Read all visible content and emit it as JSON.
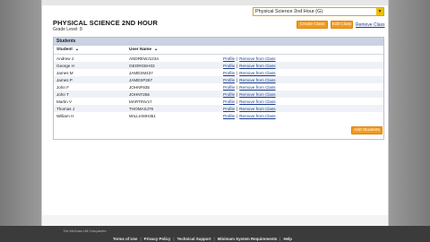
{
  "class_selector": {
    "value": "Physical Science 2nd Hour (G)"
  },
  "header": {
    "title": "PHYSICAL SCIENCE 2ND HOUR",
    "grade": "Grade Level: 8"
  },
  "actions": {
    "create_class": "Create Class",
    "edit_class": "Edit Class",
    "remove_class": "Remove Class"
  },
  "students": {
    "panel_title": "Students",
    "columns": {
      "student": "Student",
      "username": "User Name",
      "sort_glyph": "▲"
    },
    "rows": [
      {
        "student": "Andrew J",
        "username": "ANDREWJ1234",
        "profile": "Profile",
        "remove": "Remove from Class"
      },
      {
        "student": "George H",
        "username": "GEORGEH03",
        "profile": "Profile",
        "remove": "Remove from Class"
      },
      {
        "student": "James M",
        "username": "JAMESM437",
        "profile": "Profile",
        "remove": "Remove from Class"
      },
      {
        "student": "James P",
        "username": "JAMESP267",
        "profile": "Profile",
        "remove": "Remove from Class"
      },
      {
        "student": "John F",
        "username": "JOHNF935",
        "profile": "Profile",
        "remove": "Remove from Class"
      },
      {
        "student": "John T",
        "username": "JOHNT256",
        "profile": "Profile",
        "remove": "Remove from Class"
      },
      {
        "student": "Martin V",
        "username": "MARTINV17",
        "profile": "Profile",
        "remove": "Remove from Class"
      },
      {
        "student": "Thomas J",
        "username": "THOMASJ76",
        "profile": "Profile",
        "remove": "Remove from Class"
      },
      {
        "student": "William H",
        "username": "WILLIAMH351",
        "profile": "Profile",
        "remove": "Remove from Class"
      }
    ],
    "add_students": "Add Students"
  },
  "footer": {
    "logo_text": "The McGraw-Hill Companies",
    "links": [
      "Terms of Use",
      "Privacy Policy",
      "Technical Support",
      "Minimum System Requirements",
      "Help"
    ]
  },
  "colors": {
    "accent": "#f39a1c",
    "link": "#1a3d8c",
    "panel_header": "#c9d3e1",
    "footer": "#3b3b3b"
  }
}
